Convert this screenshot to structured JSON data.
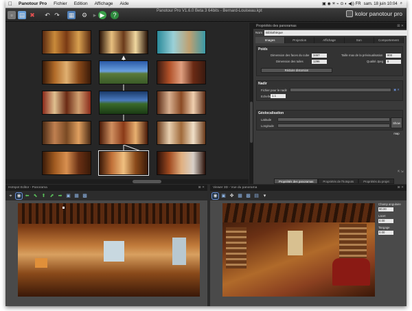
{
  "menubar": {
    "apple": "",
    "items": [
      "Panotour Pro",
      "Fichier",
      "Edition",
      "Affichage",
      "Aide"
    ],
    "datetime": "sam. 18 juin  10:04"
  },
  "window": {
    "title": "Panotour Pro V1.6.0 Beta 3 64bits - Bernard-Louiseau.kpt",
    "brand": "kolor panotour pro"
  },
  "properties": {
    "title": "Propriétés des panoramas",
    "name_label": "Nom",
    "name_value": "Bibliothèque",
    "tabs": [
      "Images",
      "Projection",
      "Affichage",
      "Son",
      "Comportement"
    ],
    "active_tab": "Images",
    "poids": {
      "header": "Poids",
      "cube_label": "Dimension des faces du cube",
      "cube_value": "3467",
      "tiles_label": "Dimension des tuiles",
      "tiles_value": "1296",
      "preview_label": "Taille max de la prévisualisation",
      "preview_value": "800",
      "quality_label": "Qualité Jpeg",
      "quality_value": "8",
      "reduce_button": "Réduire distorsion"
    },
    "nadir": {
      "header": "Nadir",
      "file_label": "Fichier pour le nadir",
      "scale_label": "Echelle",
      "scale_value": "1.1"
    },
    "geo": {
      "header": "Géolocalisation",
      "lat_label": "Latitude",
      "lon_label": "Longitude",
      "map_button": "Show map"
    },
    "bottom_tabs": [
      "Propriétés des panoramas",
      "Propriétés de l'hotspots",
      "Propriétés du projet"
    ]
  },
  "editor": {
    "title": "Hotspot Editor - Panorama",
    "toolbar": [
      "select",
      "hotspot",
      "arrow",
      "arrow",
      "arrow",
      "arrow",
      "arrow",
      "image",
      "image",
      "image"
    ]
  },
  "viewer": {
    "title": "Viewer 3D - Vue du panorama",
    "field_label": "Champ angulaire",
    "field_value": "90.00",
    "lat_label": "Lacet",
    "lat_value": "0.00",
    "tangage_label": "Tangage",
    "tangage_value": "0.00"
  },
  "colors": {
    "accent": "#6a8fd8",
    "panel_bg": "#3a3a3a",
    "window_bg": "#2b2b2b"
  }
}
